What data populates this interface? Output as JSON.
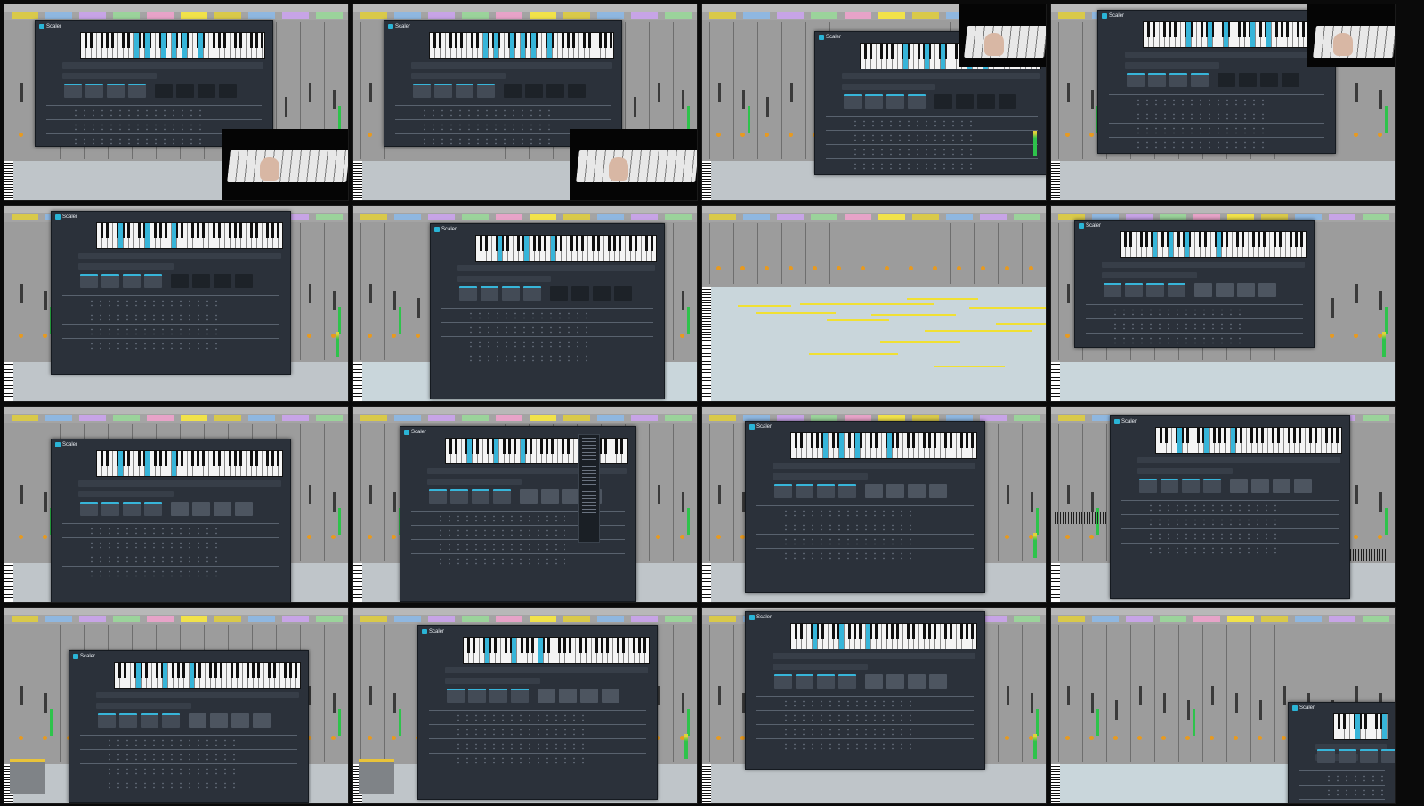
{
  "app": {
    "plugin_name": "Scaler",
    "accent_color": "#37b5d9",
    "daw_background": "#9c9c9c",
    "plugin_background": "#2b313a"
  },
  "grid": {
    "rows": 4,
    "columns": 4,
    "tiles": [
      {
        "id": 1,
        "scene": "scaler-chord-detect",
        "has_video": true,
        "video_corner": "bottom-right"
      },
      {
        "id": 2,
        "scene": "scaler-chord-detect",
        "has_video": true,
        "video_corner": "bottom-right"
      },
      {
        "id": 3,
        "scene": "scaler-chord-detect",
        "has_video": true,
        "video_corner": "top-right"
      },
      {
        "id": 4,
        "scene": "scaler-pattern-view",
        "has_video": true,
        "video_corner": "top-right"
      },
      {
        "id": 5,
        "scene": "scaler-performance",
        "has_video": false
      },
      {
        "id": 6,
        "scene": "scaler-performance",
        "has_video": false
      },
      {
        "id": 7,
        "scene": "midi-clip-editor",
        "has_video": false
      },
      {
        "id": 8,
        "scene": "scaler-performance",
        "has_video": false
      },
      {
        "id": 9,
        "scene": "scaler-performance",
        "has_video": false
      },
      {
        "id": 10,
        "scene": "scaler-dropdown-menu",
        "has_video": false
      },
      {
        "id": 11,
        "scene": "scaler-performance",
        "has_video": false
      },
      {
        "id": 12,
        "scene": "scaler-arrangement",
        "has_video": false
      },
      {
        "id": 13,
        "scene": "scaler-performance",
        "has_video": false
      },
      {
        "id": 14,
        "scene": "scaler-performance",
        "has_video": false
      },
      {
        "id": 15,
        "scene": "scaler-performance",
        "has_video": false
      },
      {
        "id": 16,
        "scene": "scaler-minimized",
        "has_video": false
      }
    ]
  },
  "icons": {
    "logo": "scaler-logo-icon",
    "piano": "piano-keyboard-icon"
  }
}
